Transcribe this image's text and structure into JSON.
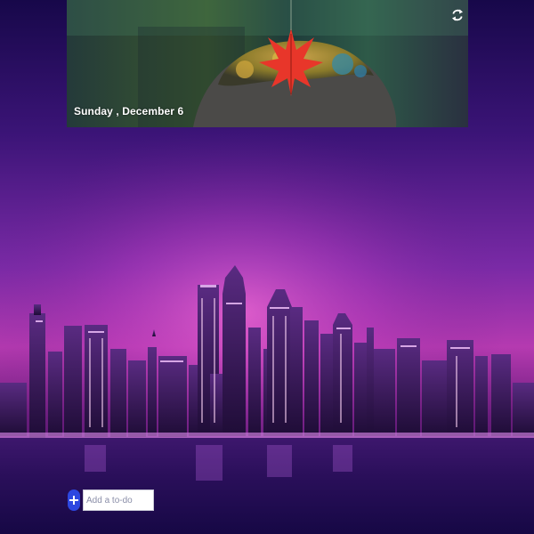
{
  "header": {
    "date_label": "Sunday , December 6"
  },
  "icons": {
    "refresh": "refresh-icon",
    "add": "plus-circle-icon"
  },
  "todo": {
    "placeholder": "Add a to-do",
    "value": ""
  },
  "colors": {
    "accent": "#2d47e0",
    "date_text": "#ffffff",
    "sky_top": "#1a0a4e",
    "sky_glow": "#d43fb0"
  }
}
